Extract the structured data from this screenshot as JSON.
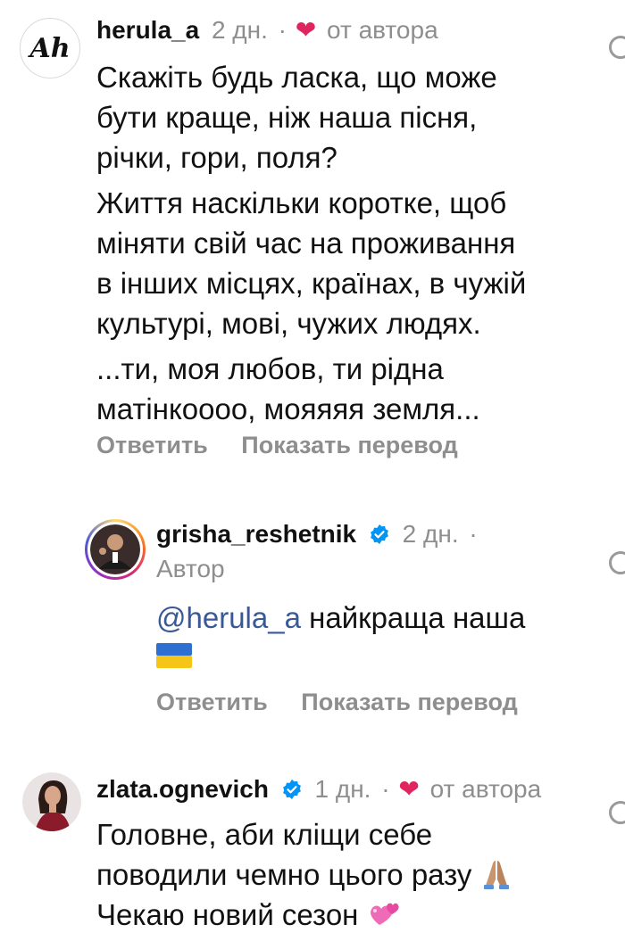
{
  "comments": [
    {
      "username": "herula_a",
      "time": "2 дн.",
      "dot": "·",
      "liked_by_author": "от автора",
      "avatar_text": "Ah",
      "paragraphs": [
        [
          "Скажіть будь ласка, що може",
          "бути краще, ніж наша пісня,",
          "річки, гори, поля?"
        ],
        [
          "Життя наскільки коротке, щоб",
          "міняти свій час на проживання",
          "в інших місцях, країнах, в чужій",
          "культурі, мові, чужих людях."
        ],
        [
          "...ти, моя любов, ти рідна",
          "матінкоооо, мояяяя земля..."
        ]
      ],
      "reply_label": "Ответить",
      "translate_label": "Показать перевод"
    },
    {
      "username": "grisha_reshetnik",
      "time": "2 дн.",
      "dot": "·",
      "author_label": "Автор",
      "mention": "@herula_a",
      "text": "найкраща наша",
      "flag_icon": "ukraine-flag-icon",
      "reply_label": "Ответить",
      "translate_label": "Показать перевод"
    },
    {
      "username": "zlata.ognevich",
      "time": "1 дн.",
      "dot": "·",
      "liked_by_author": "от автора",
      "lines": [
        "Головне, аби кліщи себе",
        "поводили чемно цього разу",
        "Чекаю новий сезон"
      ],
      "emojis": [
        "folded-hands-icon",
        "two-hearts-icon"
      ]
    }
  ],
  "colors": {
    "muted": "#8e8e8e",
    "heart": "#e0245e",
    "verified": "#0095f6",
    "mention": "#385898"
  }
}
